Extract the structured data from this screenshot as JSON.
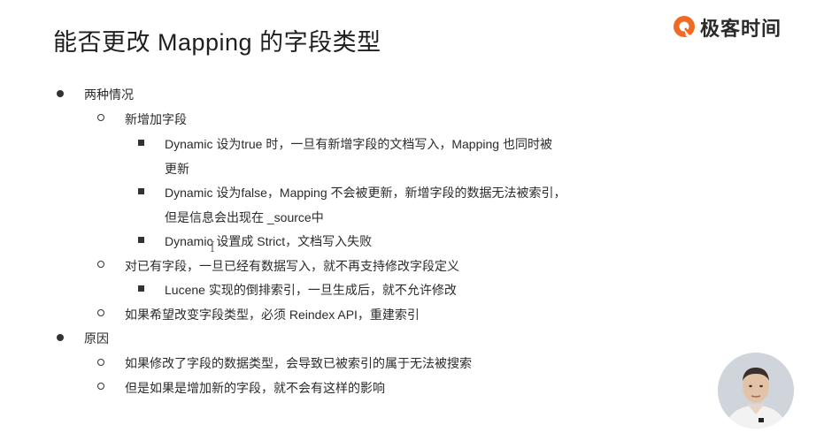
{
  "title": "能否更改 Mapping 的字段类型",
  "logo": {
    "text": "极客时间",
    "brand_color": "#f06a25",
    "icon": "geektime-logo-icon"
  },
  "bullets": {
    "l1_a": "两种情况",
    "l2_a1": "新增加字段",
    "l3_a1a_line1": "Dynamic 设为true 时，一旦有新增字段的文档写入，Mapping 也同时被",
    "l3_a1a_line2": "更新",
    "l3_a1b_line1": "Dynamic 设为false，Mapping 不会被更新，新增字段的数据无法被索引，",
    "l3_a1b_line2": "但是信息会出现在 _source中",
    "l3_a1c": "Dynamic 设置成 Strict，文档写入失败",
    "l2_a2": "对已有字段，一旦已经有数据写入，就不再支持修改字段定义",
    "l3_a2a": "Lucene 实现的倒排索引，一旦生成后，就不允许修改",
    "l2_a3": "如果希望改变字段类型，必须 Reindex API，重建索引",
    "l1_b": "原因",
    "l2_b1": "如果修改了字段的数据类型，会导致已被索引的属于无法被搜索",
    "l2_b2": "但是如果是增加新的字段，就不会有这样的影响"
  },
  "presenter": {
    "icon": "presenter-avatar-icon"
  }
}
